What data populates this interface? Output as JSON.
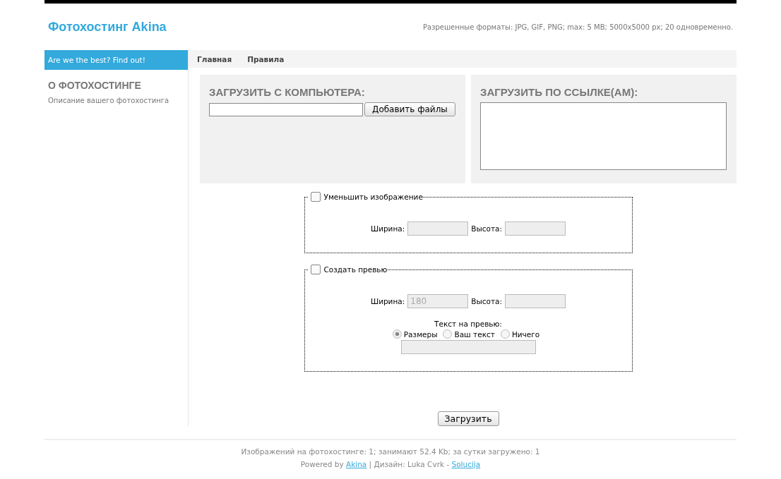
{
  "header": {
    "title": "Фотохостинг Akina",
    "formats": "Разрешенные форматы: JPG, GIF, PNG; max: 5 MB; 5000x5000 px; 20 одновременно."
  },
  "sidebar": {
    "banner": "Are we the best? Find out!",
    "heading": "О ФОТОХОСТИНГЕ",
    "description": "Описание вашего фотохостинга"
  },
  "nav": [
    {
      "label": "Главная"
    },
    {
      "label": "Правила"
    }
  ],
  "upload_local": {
    "title": "ЗАГРУЗИТЬ С КОМПЬЮТЕРА:",
    "button": "Добавить файлы"
  },
  "upload_url": {
    "title": "ЗАГРУЗИТЬ ПО ССЫЛКЕ(АМ):"
  },
  "resize": {
    "label": "Уменьшить изображение",
    "checked": false,
    "disabled": true,
    "width_label": "Ширина:",
    "height_label": "Высота:"
  },
  "preview": {
    "label": "Создать превью",
    "checked": false,
    "disabled": true,
    "width_label": "Ширина:",
    "width_value": "180",
    "height_label": "Высота:",
    "text_label": "Текст на превью:",
    "options": [
      {
        "label": "Размеры",
        "selected": true
      },
      {
        "label": "Ваш текст",
        "selected": false
      },
      {
        "label": "Ничего",
        "selected": false
      }
    ]
  },
  "submit": "Загрузить",
  "footer": {
    "stats": "Изображений на фотохостинге: 1; занимают 52.4 Kb; за сутки загружено: 1",
    "prefix": "Powered by ",
    "link1": "Akina",
    "middle": " | Дизайн: Luka Cvrk - ",
    "link2": "Solucija"
  }
}
